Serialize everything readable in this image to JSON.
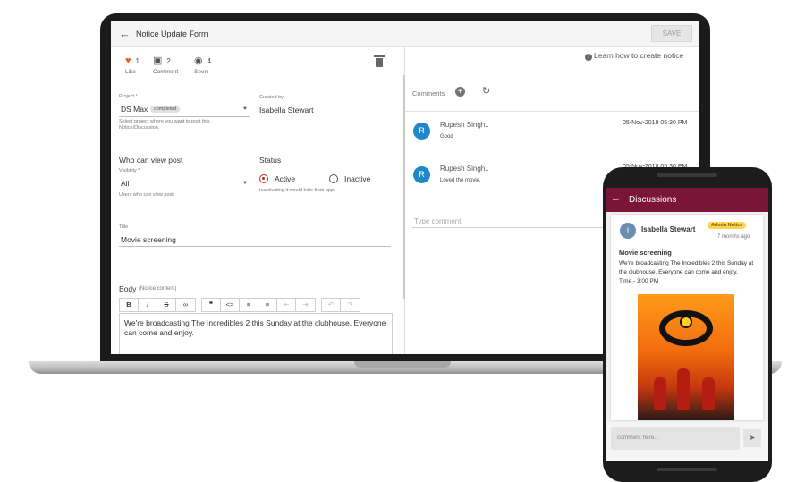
{
  "form": {
    "title": "Notice Update Form",
    "save_label": "SAVE",
    "stats": {
      "like_count": "1",
      "like_label": "Like",
      "comment_count": "2",
      "comment_label": "Comment",
      "seen_count": "4",
      "seen_label": "Seen"
    },
    "project": {
      "label": "Project *",
      "value": "DS Max",
      "badge": "completed",
      "helper": "Select project where you want to post this Notice/Discussion."
    },
    "created_by": {
      "label": "Created by",
      "value": "Isabella Stewart"
    },
    "who_can_view": {
      "heading": "Who can view post",
      "label": "Visibility *",
      "value": "All",
      "helper": "Users who can view post."
    },
    "status": {
      "heading": "Status",
      "options": [
        "Active",
        "Inactive"
      ],
      "selected": "Active",
      "helper": "Inactivating it would hide from app."
    },
    "title_field": {
      "label": "Title",
      "value": "Movie screening"
    },
    "body": {
      "label": "Body",
      "hint": "(Notice content)",
      "value": "We're broadcasting The Incredibles 2 this Sunday at the clubhouse. Everyone can come and enjoy."
    },
    "toolbar": [
      "B",
      "I",
      "S",
      "link",
      "quote",
      "<>",
      "bulleted-list",
      "numbered-list",
      "outdent",
      "indent",
      "undo",
      "redo"
    ]
  },
  "comments_panel": {
    "learn_link": "Learn how to create notice",
    "label": "Comments",
    "items": [
      {
        "initial": "R",
        "name": "Rupesh Singh..",
        "text": "Good",
        "date": "05-Nov-2018 05:30 PM"
      },
      {
        "initial": "R",
        "name": "Rupesh Singh..",
        "text": "Loved the movie.",
        "date": "05-Nov-2018 05:30 PM"
      }
    ],
    "input_placeholder": "Type comment"
  },
  "phone": {
    "title": "Discussions",
    "post": {
      "initial": "I",
      "author": "Isabella Stewart",
      "badge": "Admin Notice",
      "time": "7 months ago",
      "title": "Movie screening",
      "body": "We're broadcasting The Incredibles 2 this Sunday at the clubhouse. Everyone can come and enjoy.\nTime - 3:00 PM"
    },
    "comment_placeholder": "comment here..."
  },
  "colors": {
    "accent_red": "#c62828",
    "avatar_blue": "#1e88c8",
    "phone_header": "#7b1537",
    "admin_badge": "#ffd54f",
    "like_heart": "#f15a24"
  }
}
